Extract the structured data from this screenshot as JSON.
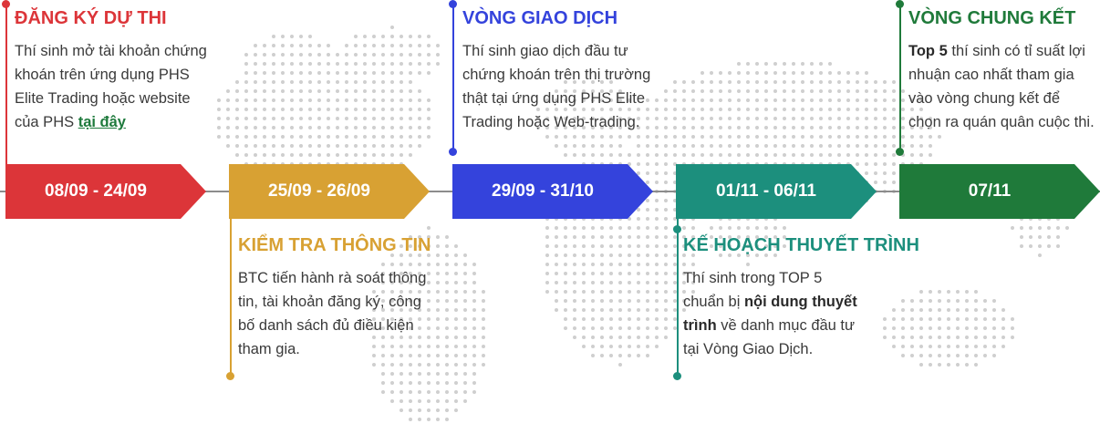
{
  "colors": {
    "red": "#dc3539",
    "gold": "#d8a133",
    "blue": "#3443dc",
    "teal": "#1c8f7d",
    "green": "#1f7a3a",
    "map_dots": "#cfcfcf",
    "line": "#8c8c8c"
  },
  "timeline": [
    {
      "date": "08/09 - 24/09"
    },
    {
      "date": "25/09 - 26/09"
    },
    {
      "date": "29/09 - 31/10"
    },
    {
      "date": "01/11 - 06/11"
    },
    {
      "date": "07/11"
    }
  ],
  "stages": {
    "registration": {
      "title": "ĐĂNG KÝ DỰ THI",
      "desc_1": "Thí sinh mở tài khoản chứng khoán trên ứng dụng PHS Elite Trading hoặc website của PHS ",
      "link": "tại đây"
    },
    "verification": {
      "title": "KIỂM TRA THÔNG TIN",
      "desc": "BTC tiến hành rà soát thông tin, tài khoản đăng ký, công bố danh sách đủ điều kiện tham gia."
    },
    "trading_round": {
      "title": "VÒNG GIAO DỊCH",
      "desc": "Thí sinh giao dịch đầu tư chứng khoán trên thị trường thật tại ứng dụng PHS Elite Trading hoặc Web-trading."
    },
    "presentation_plan": {
      "title": "KẾ HOẠCH THUYẾT TRÌNH",
      "desc_1": "Thí sinh trong TOP 5 chuẩn bị ",
      "bold": "nội dung thuyết trình",
      "desc_2": " về danh mục đầu tư tại Vòng Giao Dịch."
    },
    "final_round": {
      "title": "VÒNG CHUNG KẾT",
      "bold": "Top 5",
      "desc": " thí sinh có tỉ suất lợi nhuận cao nhất tham gia vào vòng chung kết để chọn ra quán quân cuộc thi."
    }
  }
}
